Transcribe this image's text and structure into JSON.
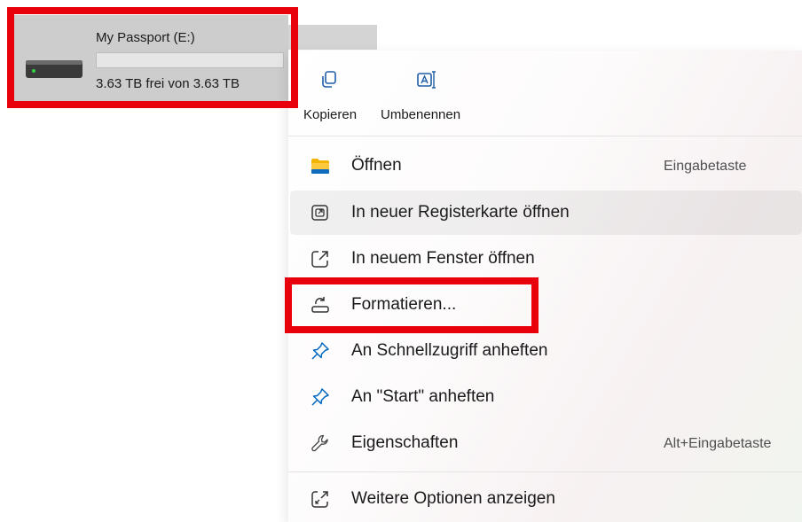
{
  "drive": {
    "name": "My Passport (E:)",
    "free_text": "3.63 TB frei von 3.63 TB",
    "used_fraction": 0.0
  },
  "quick_actions": [
    {
      "label": "Kopieren",
      "icon": "copy-icon"
    },
    {
      "label": "Umbenennen",
      "icon": "rename-icon"
    }
  ],
  "menu_items": [
    {
      "label": "Öffnen",
      "icon": "folder-icon",
      "shortcut": "Eingabetaste"
    },
    {
      "label": "In neuer Registerkarte öffnen",
      "icon": "new-tab-icon",
      "shortcut": ""
    },
    {
      "label": "In neuem Fenster öffnen",
      "icon": "new-window-icon",
      "shortcut": ""
    },
    {
      "label": "Formatieren...",
      "icon": "format-icon",
      "shortcut": ""
    },
    {
      "label": "An Schnellzugriff anheften",
      "icon": "pin-icon",
      "shortcut": ""
    },
    {
      "label": "An \"Start\" anheften",
      "icon": "pin-icon",
      "shortcut": ""
    },
    {
      "label": "Eigenschaften",
      "icon": "wrench-icon",
      "shortcut": "Alt+Eingabetaste"
    },
    {
      "label": "Weitere Optionen anzeigen",
      "icon": "more-options-icon",
      "shortcut": ""
    }
  ],
  "colors": {
    "highlight": "#e8000b",
    "accent": "#0067c0",
    "folder": "#f2b400"
  }
}
